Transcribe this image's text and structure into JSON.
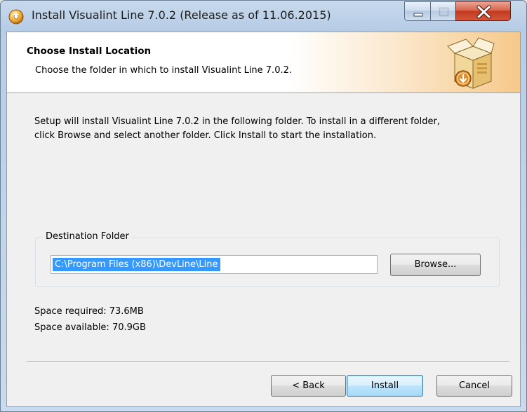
{
  "window": {
    "title": "Install Visualint Line 7.0.2 (Release as of 11.06.2015)",
    "icon": "installer-disc-icon",
    "controls": [
      "minimize-icon",
      "maximize-icon",
      "close-icon"
    ]
  },
  "header": {
    "title": "Choose Install Location",
    "subtitle": "Choose the folder in which to install Visualint Line 7.0.2.",
    "icon": "package-box-icon"
  },
  "body": {
    "description_line1": "Setup will install Visualint Line 7.0.2 in the following folder. To install in a different folder,",
    "description_line2": "click Browse and select another folder. Click Install to start the installation."
  },
  "destination": {
    "group_label": "Destination Folder",
    "path": "C:\\Program Files (x86)\\DevLine\\Line",
    "browse_label": "Browse..."
  },
  "space": {
    "required": "Space required: 73.6MB",
    "available": "Space available: 70.9GB"
  },
  "footer": {
    "back_label": "< Back",
    "install_label": "Install",
    "cancel_label": "Cancel"
  },
  "colors": {
    "selection": "#3399ff",
    "titlebar": "#b7cde6",
    "close_button": "#c23a1f"
  }
}
